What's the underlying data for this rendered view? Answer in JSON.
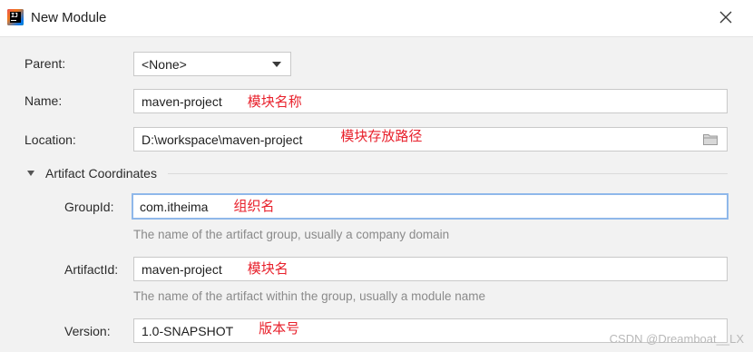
{
  "window": {
    "title": "New Module"
  },
  "form": {
    "parent": {
      "label": "Parent:",
      "value": "<None>"
    },
    "name": {
      "label": "Name:",
      "value": "maven-project",
      "note": "模块名称"
    },
    "location": {
      "label": "Location:",
      "value": "D:\\workspace\\maven-project",
      "note": "模块存放路径"
    },
    "section": {
      "label": "Artifact Coordinates",
      "expanded": true
    },
    "group_id": {
      "label": "GroupId:",
      "value": "com.itheima",
      "note": "组织名",
      "hint": "The name of the artifact group, usually a company domain"
    },
    "artifact_id": {
      "label": "ArtifactId:",
      "value": "maven-project",
      "note": "模块名",
      "hint": "The name of the artifact within the group, usually a module name"
    },
    "version": {
      "label": "Version:",
      "value": "1.0-SNAPSHOT",
      "note": "版本号"
    }
  },
  "watermark": "CSDN @Dreamboat__LX",
  "colors": {
    "annotation": "#e8212c",
    "focus_border": "#8fb8ea",
    "hint": "#8a8a8a"
  },
  "icons": {
    "app": "intellij-logo-icon",
    "close": "close-icon",
    "dropdown": "chevron-down-icon",
    "browse": "folder-icon",
    "section_toggle": "triangle-down-icon"
  }
}
